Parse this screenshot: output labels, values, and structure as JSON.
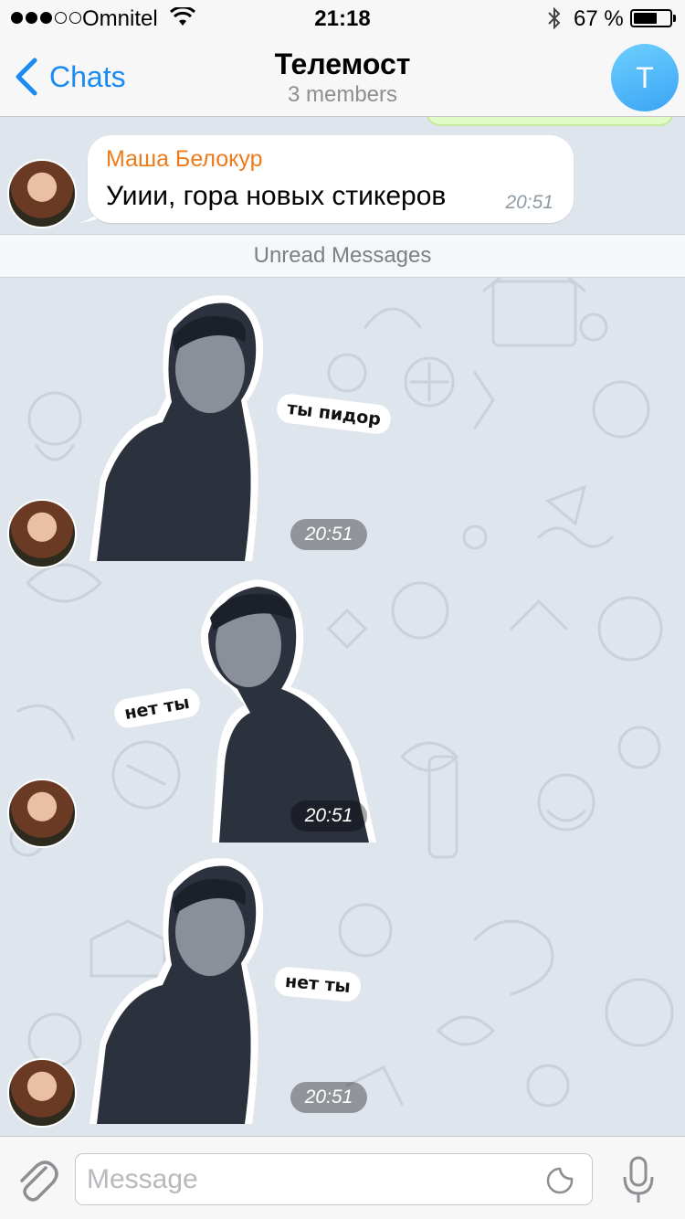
{
  "status_bar": {
    "carrier": "Omnitel",
    "time": "21:18",
    "battery_percent": "67 %",
    "battery_level": 0.67,
    "signal_bars": 3,
    "signal_total": 5
  },
  "navbar": {
    "back_label": "Chats",
    "title": "Телемост",
    "subtitle": "3 members",
    "avatar_initial": "T",
    "accent_color": "#1a8bf0"
  },
  "messages": [
    {
      "type": "text",
      "sender": "Маша Белокур",
      "sender_color": "#ee7b1a",
      "text": "Уиии, гора новых стикеров",
      "time": "20:51"
    }
  ],
  "unread_divider": "Unread Messages",
  "stickers": [
    {
      "caption": "ты пидор",
      "time": "20:51"
    },
    {
      "caption": "нет ты",
      "time": "20:51"
    },
    {
      "caption": "нет ты",
      "time": "20:51"
    }
  ],
  "input_bar": {
    "placeholder": "Message",
    "icons": [
      "paperclip-icon",
      "sticker-icon",
      "microphone-icon"
    ]
  }
}
